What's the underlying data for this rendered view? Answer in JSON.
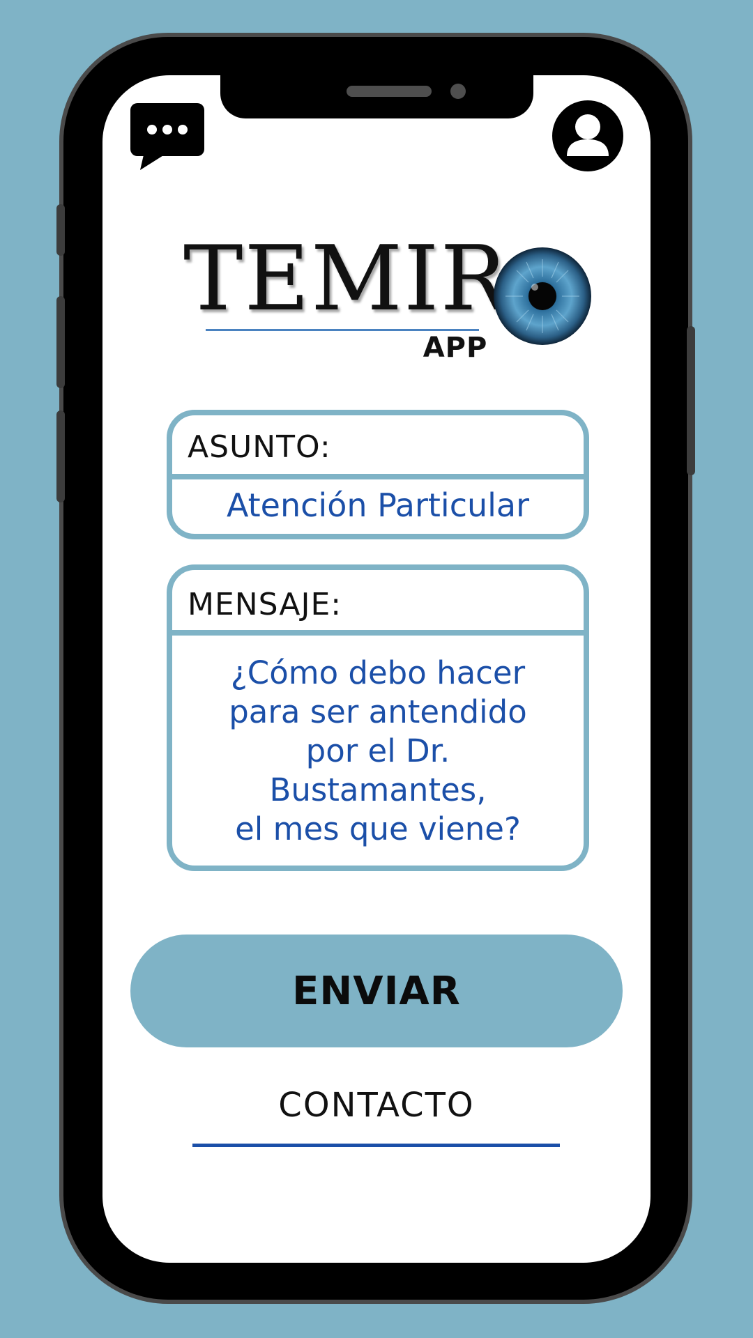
{
  "header": {
    "chat_icon": "chat-bubble-icon",
    "profile_icon": "user-profile-icon"
  },
  "logo": {
    "wordmark": "TEMIR",
    "suffix": "APP",
    "eye_icon": "eye-icon"
  },
  "form": {
    "subject_label": "ASUNTO:",
    "subject_value": "Atención Particular",
    "message_label": "MENSAJE:",
    "message_value": "¿Cómo debo hacer\npara ser antendido\npor el Dr.\nBustamantes,\nel mes que viene?"
  },
  "actions": {
    "send_label": "ENVIAR",
    "contact_label": "CONTACTO"
  },
  "colors": {
    "background": "#7fb3c6",
    "accent_border": "#7fb3c6",
    "value_text": "#1b4fa8",
    "button_fill": "#7fb3c6"
  }
}
